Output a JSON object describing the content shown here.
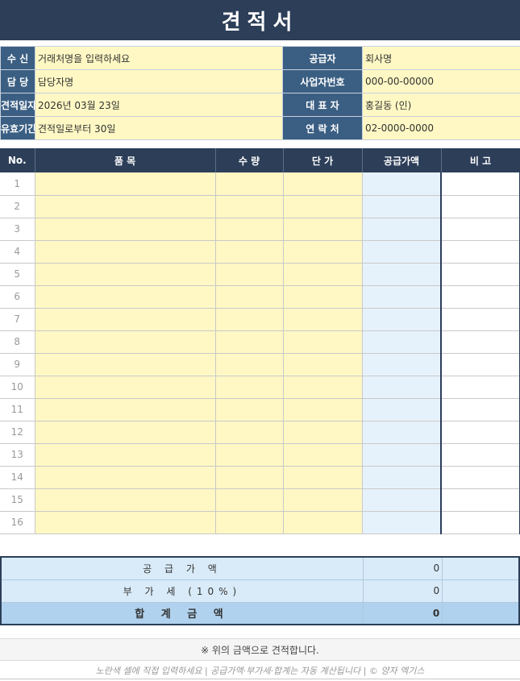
{
  "document": {
    "title": "견적서"
  },
  "info": {
    "rows": [
      {
        "left_label": "수  신",
        "left_value": "거래처명을 입력하세요",
        "right_label": "공급자",
        "right_value": "회사명"
      },
      {
        "left_label": "담  당",
        "left_value": "담당자명",
        "right_label": "사업자번호",
        "right_value": "000-00-00000"
      },
      {
        "left_label": "견적일자",
        "left_value": "2026년 03월 23일",
        "right_label": "대 표 자",
        "right_value": "홍길동 (인)"
      },
      {
        "left_label": "유효기간",
        "left_value": "견적일로부터 30일",
        "right_label": "연 락 처",
        "right_value": "02-0000-0000"
      }
    ]
  },
  "items": {
    "headers": {
      "no": "No.",
      "item": "품  목",
      "qty": "수 량",
      "price": "단 가",
      "amount": "공급가액",
      "note": "비 고"
    },
    "rows": [
      {
        "no": "1"
      },
      {
        "no": "2"
      },
      {
        "no": "3"
      },
      {
        "no": "4"
      },
      {
        "no": "5"
      },
      {
        "no": "6"
      },
      {
        "no": "7"
      },
      {
        "no": "8"
      },
      {
        "no": "9"
      },
      {
        "no": "10"
      },
      {
        "no": "11"
      },
      {
        "no": "12"
      },
      {
        "no": "13"
      },
      {
        "no": "14"
      },
      {
        "no": "15"
      },
      {
        "no": "16"
      }
    ]
  },
  "summary": {
    "supply": {
      "label": "공 급 가 액",
      "value": "0"
    },
    "vat": {
      "label": "부 가 세 (10%)",
      "value": "0"
    },
    "total": {
      "label": "합 계 금 액",
      "value": "0"
    }
  },
  "note": "※ 위의 금액으로 견적합니다.",
  "footer": "노란색 셀에 직접 입력하세요 | 공급가액·부가세·합계는 자동 계산됩니다 | © 양자 엑기스",
  "colors": {
    "header_bg": "#2c3e58",
    "label_bg": "#3b5f83",
    "input_bg": "#fff8c4",
    "calc_bg": "#e6f2fb",
    "sum_bg": "#d9ebf8"
  }
}
